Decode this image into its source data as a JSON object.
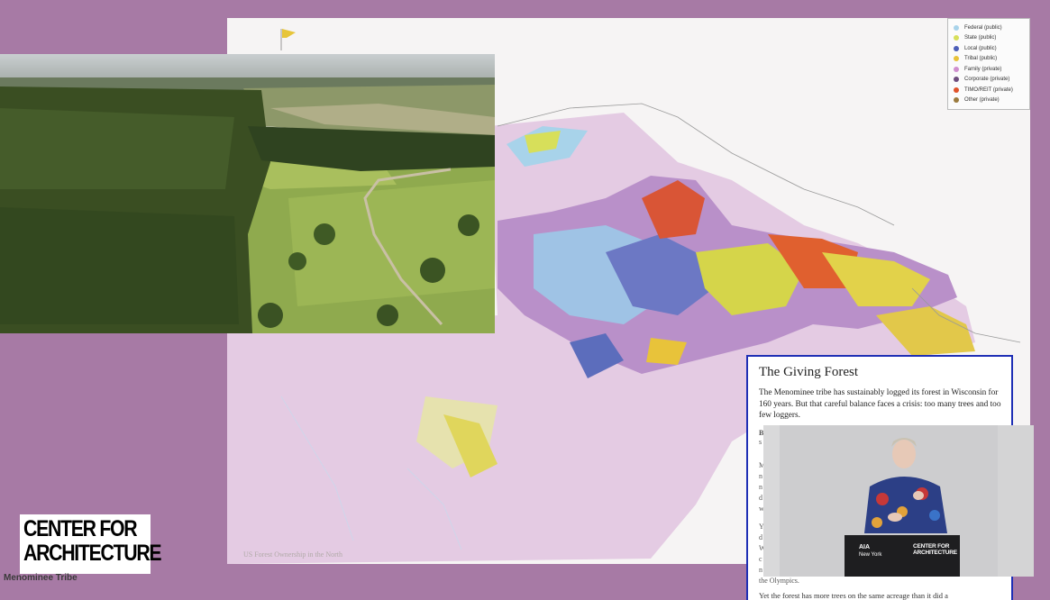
{
  "slide": {
    "map_caption": "US Forest Ownership in the North",
    "legend": [
      {
        "label": "Federal (public)",
        "color": "#a8d3ea"
      },
      {
        "label": "State (public)",
        "color": "#d7df5a"
      },
      {
        "label": "Local (public)",
        "color": "#4d5fb8"
      },
      {
        "label": "Tribal (public)",
        "color": "#e8c33a"
      },
      {
        "label": "Family (private)",
        "color": "#d08fcf"
      },
      {
        "label": "Corporate (private)",
        "color": "#6e4d7e"
      },
      {
        "label": "TIMO/REIT (private)",
        "color": "#e0532a"
      },
      {
        "label": "Other (private)",
        "color": "#9b7b3e"
      }
    ]
  },
  "article": {
    "title": "The Giving Forest",
    "lede": "The Menominee tribe has sustainably logged its forest in Wisconsin for 160 years. But that careful balance faces a crisis: too many trees and too few loggers.",
    "fragments": [
      "B",
      "s",
      "M",
      "n",
      "n",
      "d",
      "w",
      "Y",
      "d",
      "W",
      "c",
      "n",
      "the Olympics."
    ],
    "bottom_line": "Yet the forest has more trees on the same acreage than it did a"
  },
  "video": {
    "podium_line1": "AIA",
    "podium_line2": "New York",
    "podium_logo_line1": "CENTER FOR",
    "podium_logo_line2": "ARCHITECTURE"
  },
  "branding": {
    "logo_line1": "CENTER FOR",
    "logo_line2": "ARCHITECTURE",
    "subtitle": "Menominee Tribe"
  }
}
